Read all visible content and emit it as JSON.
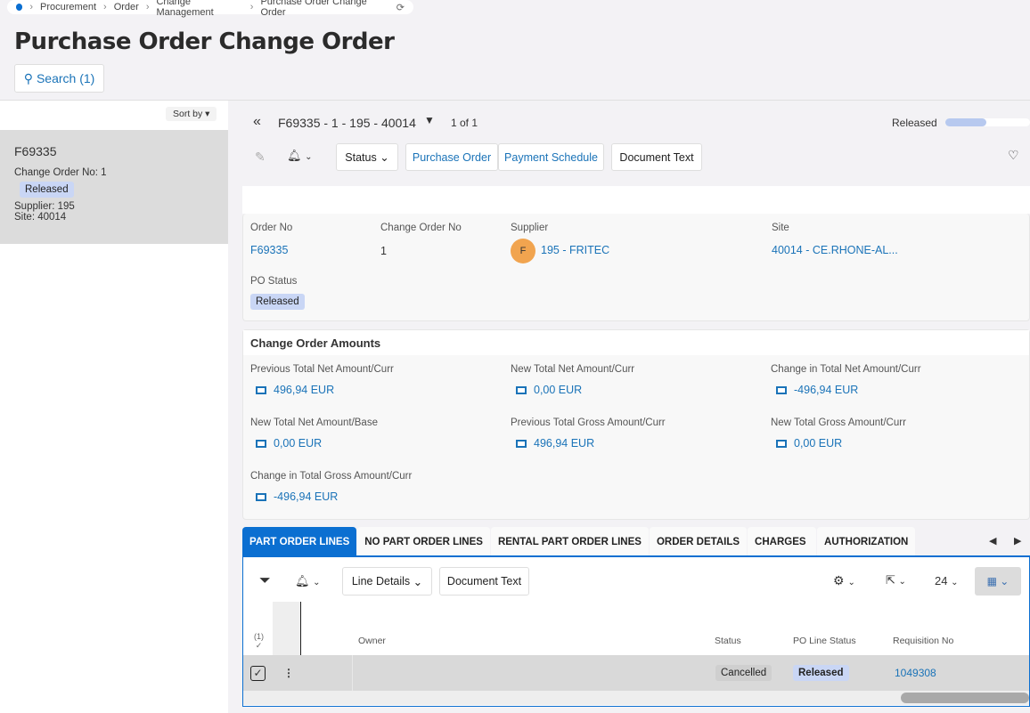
{
  "breadcrumb": [
    "Procurement",
    "Order",
    "Change Management",
    "Purchase Order Change Order"
  ],
  "page_title": "Purchase Order Change Order",
  "search_label": "Search (1)",
  "sort_label": "Sort by",
  "list": {
    "title": "F69335",
    "change_order_label": "Change Order No:",
    "change_order": "1",
    "status": "Released",
    "supplier_label": "Supplier:",
    "supplier": "195",
    "site_label": "Site:",
    "site": "40014"
  },
  "record": {
    "title": "F69335 - 1 - 195 - 40014",
    "count": "1 of 1",
    "state": "Released",
    "progress": 0.4
  },
  "toolbar": {
    "status": "Status",
    "purchase_order": "Purchase Order",
    "payment_schedule": "Payment Schedule",
    "document_text": "Document Text"
  },
  "header": {
    "order_no_label": "Order No",
    "order_no": "F69335",
    "change_no_label": "Change Order No",
    "change_no": "1",
    "supplier_label": "Supplier",
    "supplier_initial": "F",
    "supplier": "195 - FRITEC",
    "site_label": "Site",
    "site": "40014 - CE.RHONE-AL...",
    "po_status_label": "PO Status",
    "po_status": "Released"
  },
  "amounts": {
    "title": "Change Order Amounts",
    "items": [
      {
        "label": "Previous Total Net Amount/Curr",
        "value": "496,94 EUR"
      },
      {
        "label": "New Total Net Amount/Curr",
        "value": "0,00 EUR"
      },
      {
        "label": "Change in Total Net Amount/Curr",
        "value": "-496,94 EUR"
      },
      {
        "label": "New Total Net Amount/Base",
        "value": "0,00 EUR"
      },
      {
        "label": "Previous Total Gross Amount/Curr",
        "value": "496,94 EUR"
      },
      {
        "label": "New Total Gross Amount/Curr",
        "value": "0,00 EUR"
      },
      {
        "label": "Change in Total Gross Amount/Curr",
        "value": "-496,94 EUR"
      }
    ]
  },
  "tabs": [
    "PART ORDER LINES",
    "NO PART ORDER LINES",
    "RENTAL PART ORDER LINES",
    "ORDER DETAILS",
    "CHARGES",
    "AUTHORIZATION"
  ],
  "grid": {
    "line_details": "Line Details",
    "document_text": "Document Text",
    "page_size": "24",
    "selected_count": "(1)",
    "columns": [
      "Owner",
      "Status",
      "PO Line Status",
      "Requisition No"
    ],
    "rows": [
      {
        "owner": "",
        "status": "Cancelled",
        "po_line_status": "Released",
        "requisition_no": "1049308"
      }
    ]
  }
}
